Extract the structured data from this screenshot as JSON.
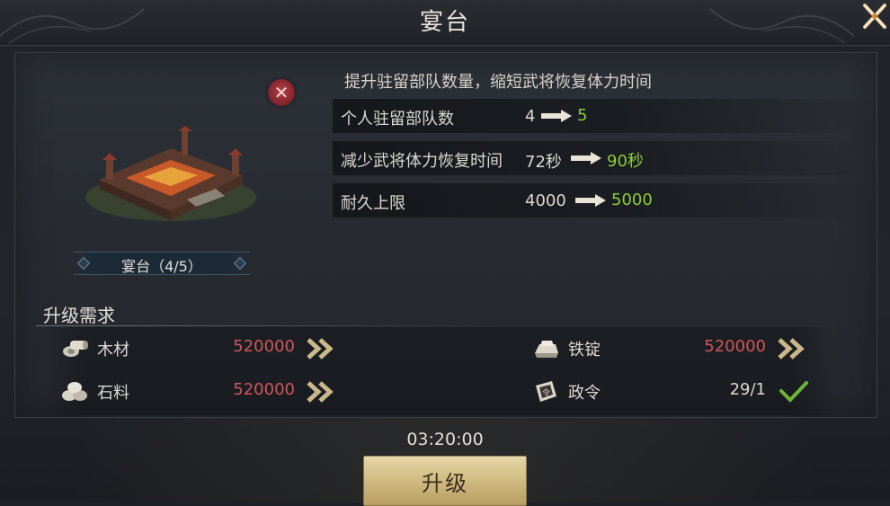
{
  "header": {
    "title": "宴台"
  },
  "building": {
    "name_label": "宴台（4/5）"
  },
  "description": "提升驻留部队数量，缩短武将恢复体力时间",
  "stats": [
    {
      "label": "个人驻留部队数",
      "from": "4",
      "to": "5"
    },
    {
      "label": "减少武将体力恢复时间",
      "from": "72秒",
      "to": "90秒"
    },
    {
      "label": "耐久上限",
      "from": "4000",
      "to": "5000"
    }
  ],
  "requirements": {
    "title": "升级需求",
    "items": [
      {
        "name": "木材",
        "amount": "520000",
        "icon": "wood-icon",
        "status": "insufficient"
      },
      {
        "name": "铁锭",
        "amount": "520000",
        "icon": "iron-ingot-icon",
        "status": "insufficient"
      },
      {
        "name": "石料",
        "amount": "520000",
        "icon": "stone-icon",
        "status": "insufficient"
      },
      {
        "name": "政令",
        "amount": "29/1",
        "icon": "decree-icon",
        "status": "ok"
      }
    ]
  },
  "timer": "03:20:00",
  "upgrade_button": {
    "label": "升级"
  },
  "colors": {
    "increase_green": "#8ccc3a",
    "insufficient_red": "#d0575a",
    "ok_check_green": "#6fb43a",
    "button_gold": "#d2bd85"
  }
}
